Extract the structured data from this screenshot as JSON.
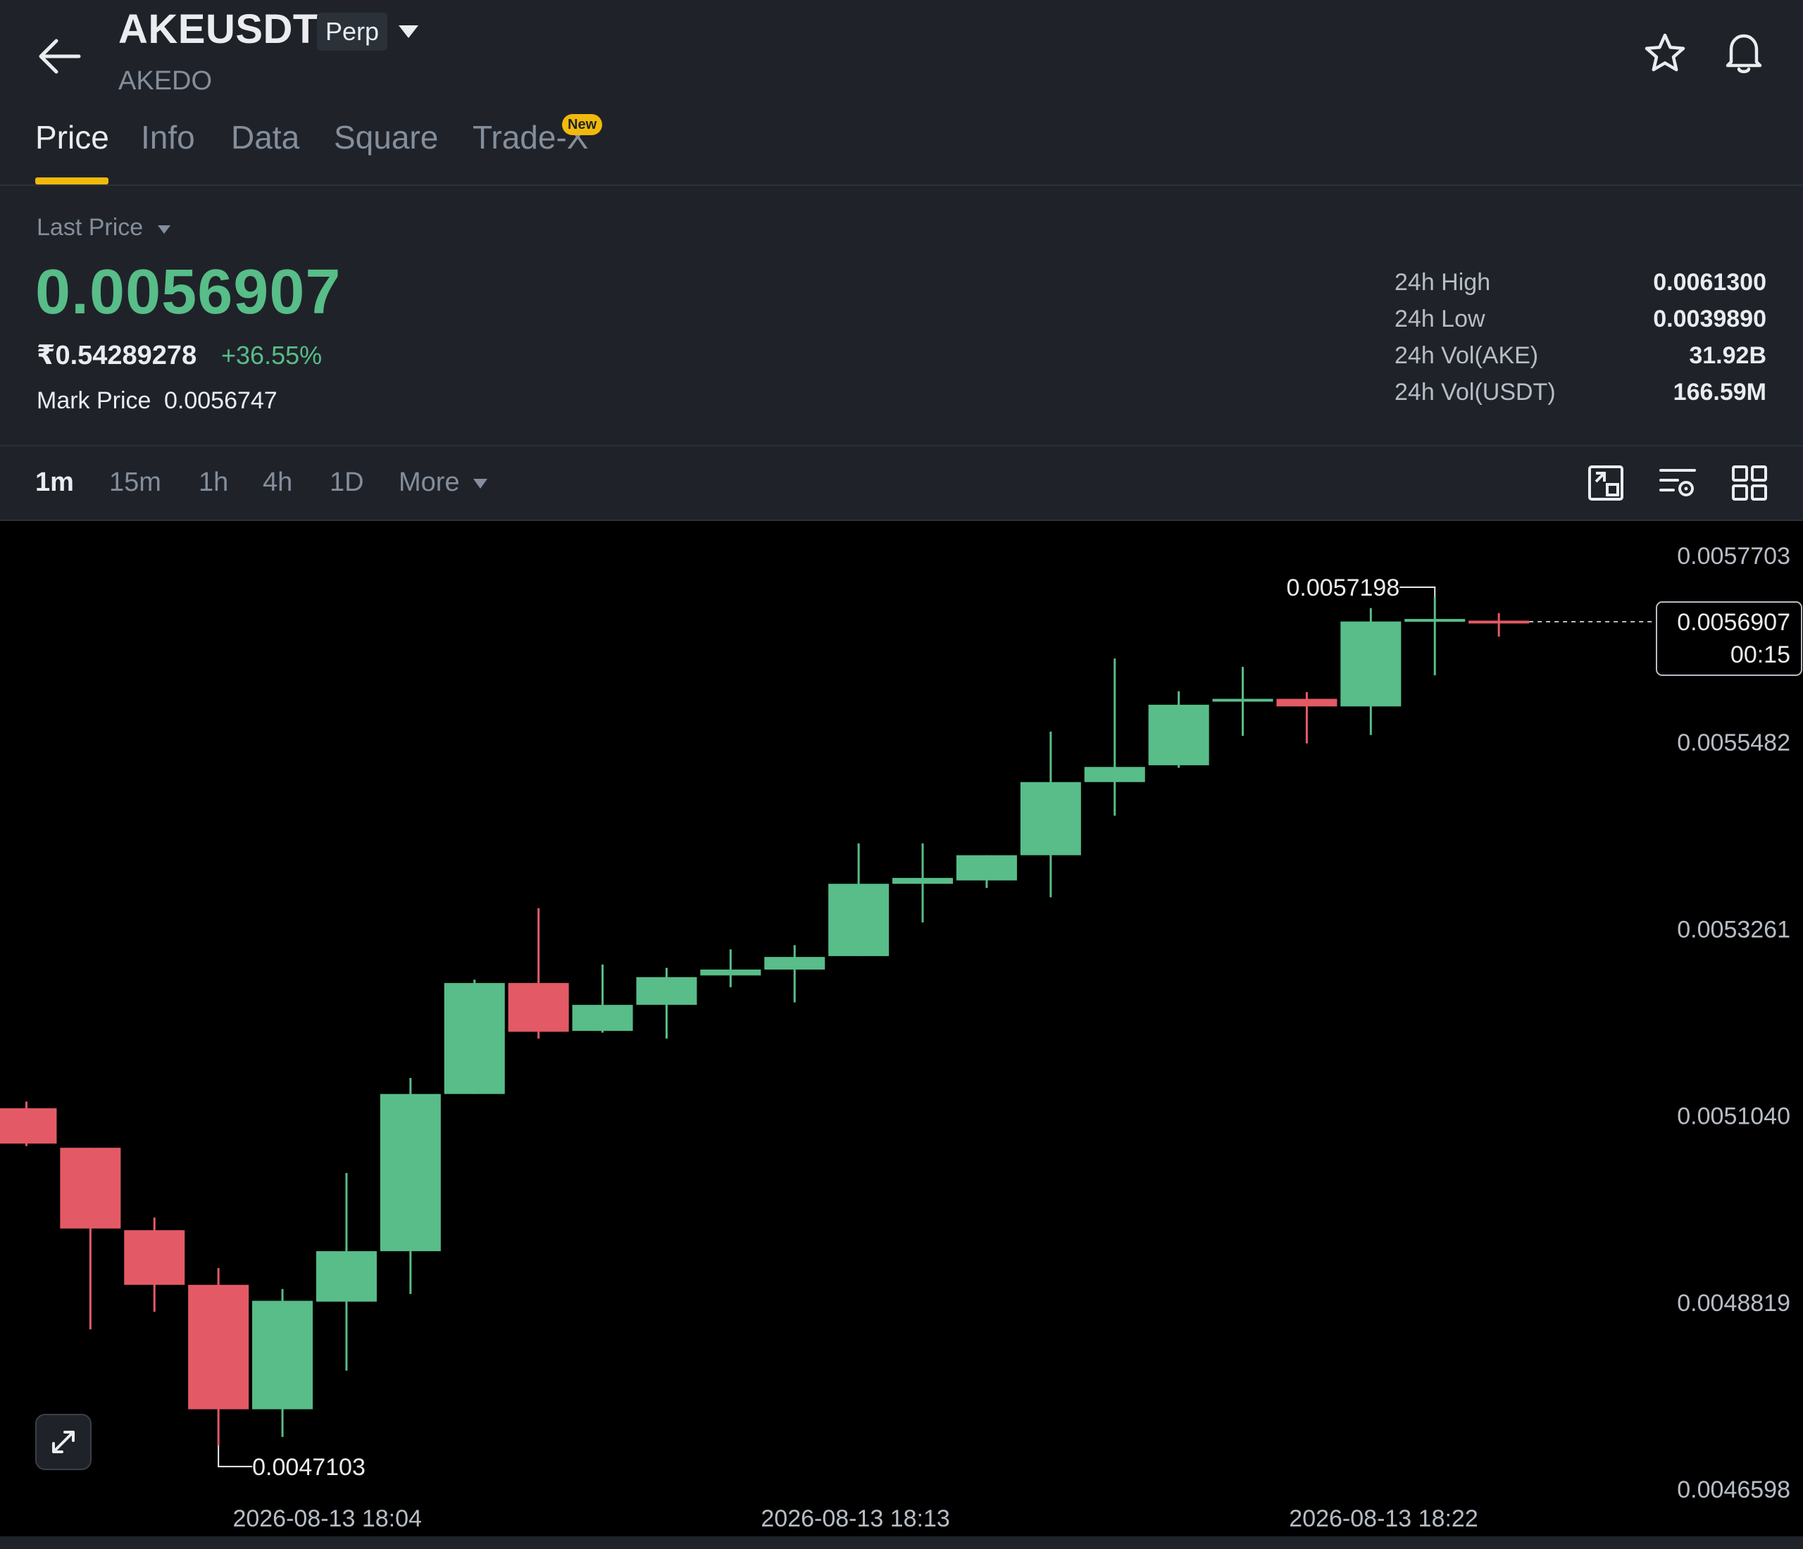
{
  "header": {
    "symbol": "AKEUSDT",
    "contract_type": "Perp",
    "base_name": "AKEDO",
    "icons": {
      "back": "arrow-left-icon",
      "favorite": "star-icon",
      "alert": "bell-icon",
      "switch": "caret-down-icon"
    }
  },
  "tabs": [
    {
      "label": "Price",
      "active": true
    },
    {
      "label": "Info",
      "active": false
    },
    {
      "label": "Data",
      "active": false
    },
    {
      "label": "Square",
      "active": false
    },
    {
      "label": "Trade-X",
      "active": false,
      "badge": "New"
    }
  ],
  "price": {
    "label": "Last Price",
    "last_price": "0.0056907",
    "fiat_price": "₹0.54289278",
    "change_pct": "+36.55%",
    "mark_price_label": "Mark Price",
    "mark_price": "0.0056747"
  },
  "stats": [
    {
      "label": "24h High",
      "value": "0.0061300"
    },
    {
      "label": "24h Low",
      "value": "0.0039890"
    },
    {
      "label": "24h Vol(AKE)",
      "value": "31.92B"
    },
    {
      "label": "24h Vol(USDT)",
      "value": "166.59M"
    }
  ],
  "intervals": {
    "items": [
      {
        "label": "1m",
        "active": true
      },
      {
        "label": "15m",
        "active": false
      },
      {
        "label": "1h",
        "active": false
      },
      {
        "label": "4h",
        "active": false
      },
      {
        "label": "1D",
        "active": false
      }
    ],
    "more_label": "More",
    "tools": [
      "chart-style-icon",
      "indicator-settings-icon",
      "layout-grid-icon"
    ]
  },
  "chart_data": {
    "type": "candlestick",
    "y_ticks": [
      "0.0057703",
      "0.0055482",
      "0.0053261",
      "0.0051040",
      "0.0048819",
      "0.0046598"
    ],
    "x_ticks": [
      "2026-08-13 18:04",
      "2026-08-13 18:13",
      "2026-08-13 18:22"
    ],
    "ylim": [
      0.0046598,
      0.0057703
    ],
    "high_label": "0.0057198",
    "low_label": "0.0047103",
    "current_price": "0.0056907",
    "countdown": "00:15",
    "up_color": "#58bd88",
    "down_color": "#e35a66",
    "candles": [
      {
        "o": 0.005112,
        "h": 0.00512,
        "l": 0.005067,
        "c": 0.00507
      },
      {
        "o": 0.005065,
        "h": 0.005065,
        "l": 0.004849,
        "c": 0.004969
      },
      {
        "o": 0.004967,
        "h": 0.004982,
        "l": 0.00487,
        "c": 0.004902
      },
      {
        "o": 0.004902,
        "h": 0.004922,
        "l": 0.004711,
        "c": 0.004754
      },
      {
        "o": 0.004754,
        "h": 0.004897,
        "l": 0.004721,
        "c": 0.004883
      },
      {
        "o": 0.004882,
        "h": 0.005035,
        "l": 0.0048,
        "c": 0.004942
      },
      {
        "o": 0.004942,
        "h": 0.005148,
        "l": 0.004891,
        "c": 0.005129
      },
      {
        "o": 0.005129,
        "h": 0.005265,
        "l": 0.005129,
        "c": 0.005261
      },
      {
        "o": 0.005261,
        "h": 0.00535,
        "l": 0.005195,
        "c": 0.005203
      },
      {
        "o": 0.005204,
        "h": 0.005283,
        "l": 0.005202,
        "c": 0.005235
      },
      {
        "o": 0.005235,
        "h": 0.005279,
        "l": 0.005195,
        "c": 0.005268
      },
      {
        "o": 0.00527,
        "h": 0.005301,
        "l": 0.005256,
        "c": 0.005277
      },
      {
        "o": 0.005277,
        "h": 0.005306,
        "l": 0.005238,
        "c": 0.005292
      },
      {
        "o": 0.005293,
        "h": 0.005427,
        "l": 0.005293,
        "c": 0.005379
      },
      {
        "o": 0.005379,
        "h": 0.005427,
        "l": 0.005333,
        "c": 0.005386
      },
      {
        "o": 0.005383,
        "h": 0.005413,
        "l": 0.005374,
        "c": 0.005413
      },
      {
        "o": 0.005413,
        "h": 0.00556,
        "l": 0.005363,
        "c": 0.0055
      },
      {
        "o": 0.0055,
        "h": 0.005647,
        "l": 0.00546,
        "c": 0.005518
      },
      {
        "o": 0.00552,
        "h": 0.005608,
        "l": 0.005517,
        "c": 0.005592
      },
      {
        "o": 0.005596,
        "h": 0.005637,
        "l": 0.005555,
        "c": 0.005599
      },
      {
        "o": 0.005599,
        "h": 0.005607,
        "l": 0.005546,
        "c": 0.00559
      },
      {
        "o": 0.00559,
        "h": 0.005707,
        "l": 0.005556,
        "c": 0.005691
      },
      {
        "o": 0.005691,
        "h": 0.00572,
        "l": 0.005627,
        "c": 0.005694
      },
      {
        "o": 0.005692,
        "h": 0.005701,
        "l": 0.005673,
        "c": 0.0056907
      }
    ]
  }
}
